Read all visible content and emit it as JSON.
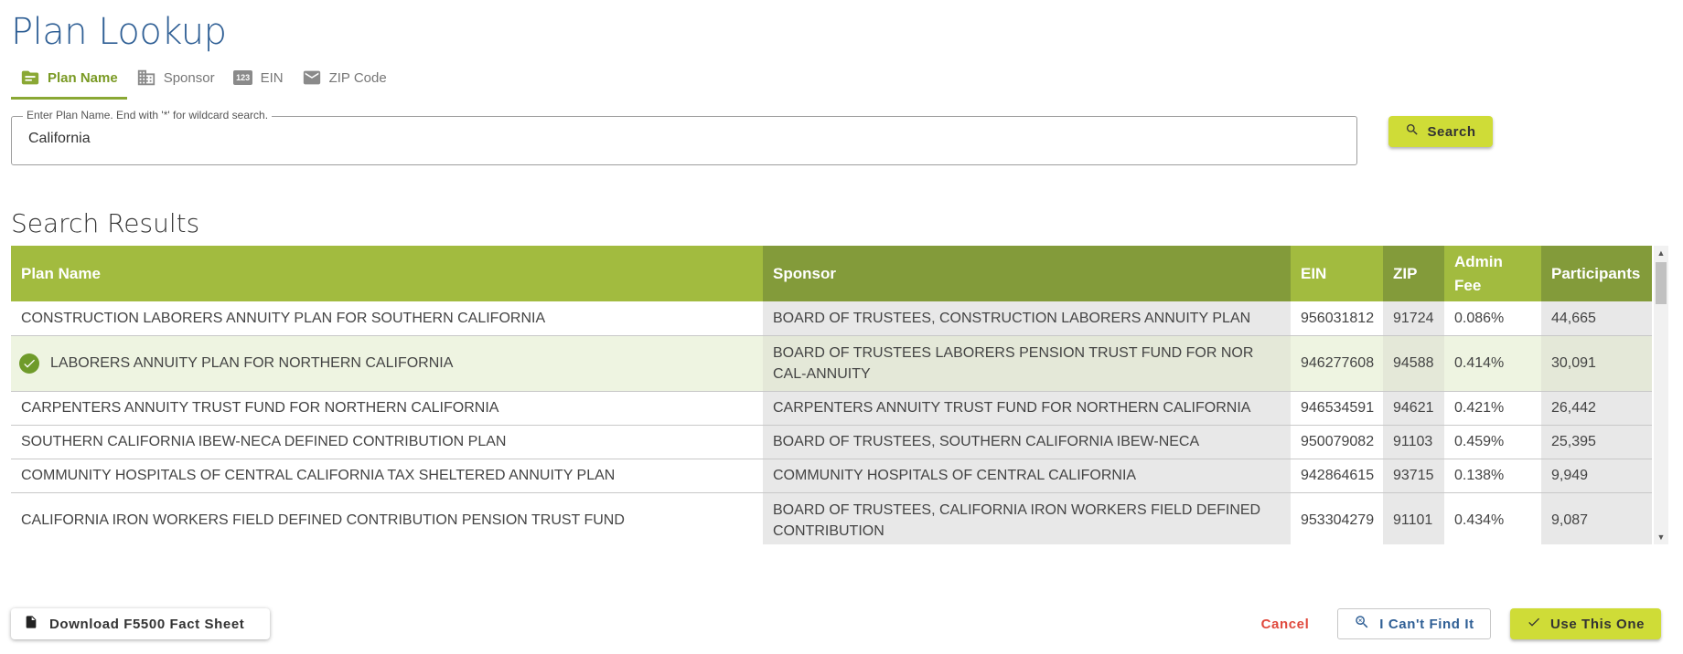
{
  "title": "Plan Lookup",
  "tabs": [
    {
      "label": "Plan Name",
      "icon": "plan-name-icon",
      "active": true
    },
    {
      "label": "Sponsor",
      "icon": "building-icon",
      "active": false
    },
    {
      "label": "EIN",
      "icon": "123-icon",
      "badge": "123",
      "active": false
    },
    {
      "label": "ZIP Code",
      "icon": "envelope-icon",
      "active": false
    }
  ],
  "search": {
    "legend": "Enter Plan Name. End with '*' for wildcard search.",
    "value": "California",
    "button_label": "Search"
  },
  "results": {
    "title": "Search Results",
    "columns": [
      "Plan Name",
      "Sponsor",
      "EIN",
      "ZIP",
      "Admin Fee",
      "Participants"
    ],
    "rows": [
      {
        "plan": "CONSTRUCTION LABORERS ANNUITY PLAN FOR SOUTHERN CALIFORNIA",
        "sponsor": "BOARD OF TRUSTEES, CONSTRUCTION LABORERS ANNUITY PLAN",
        "ein": "956031812",
        "zip": "91724",
        "fee": "0.086%",
        "participants": "44,665",
        "selected": false
      },
      {
        "plan": "LABORERS ANNUITY PLAN FOR NORTHERN CALIFORNIA",
        "sponsor": "BOARD OF TRUSTEES LABORERS PENSION TRUST FUND FOR NOR CAL-ANNUITY",
        "ein": "946277608",
        "zip": "94588",
        "fee": "0.414%",
        "participants": "30,091",
        "selected": true
      },
      {
        "plan": "CARPENTERS ANNUITY TRUST FUND FOR NORTHERN CALIFORNIA",
        "sponsor": "CARPENTERS ANNUITY TRUST FUND FOR NORTHERN CALIFORNIA",
        "ein": "946534591",
        "zip": "94621",
        "fee": "0.421%",
        "participants": "26,442",
        "selected": false
      },
      {
        "plan": "SOUTHERN CALIFORNIA IBEW-NECA DEFINED CONTRIBUTION PLAN",
        "sponsor": "BOARD OF TRUSTEES, SOUTHERN CALIFORNIA IBEW-NECA",
        "ein": "950079082",
        "zip": "91103",
        "fee": "0.459%",
        "participants": "25,395",
        "selected": false
      },
      {
        "plan": "COMMUNITY HOSPITALS OF CENTRAL CALIFORNIA TAX SHELTERED ANNUITY PLAN",
        "sponsor": "COMMUNITY HOSPITALS OF CENTRAL CALIFORNIA",
        "ein": "942864615",
        "zip": "93715",
        "fee": "0.138%",
        "participants": "9,949",
        "selected": false
      },
      {
        "plan": "CALIFORNIA IRON WORKERS FIELD DEFINED CONTRIBUTION PENSION TRUST FUND",
        "sponsor": "BOARD OF TRUSTEES, CALIFORNIA IRON WORKERS FIELD DEFINED CONTRIBUTION",
        "ein": "953304279",
        "zip": "91101",
        "fee": "0.434%",
        "participants": "9,087",
        "selected": false
      }
    ]
  },
  "actions": {
    "download_label": "Download F5500 Fact Sheet",
    "cancel_label": "Cancel",
    "cant_find_label": "I Can't Find It",
    "use_label": "Use This One"
  },
  "colors": {
    "title": "#2f5f95",
    "accent": "#cfdc37",
    "header_light": "#a2bb3f",
    "header_dark": "#839b3a",
    "cancel": "#e0493d"
  }
}
